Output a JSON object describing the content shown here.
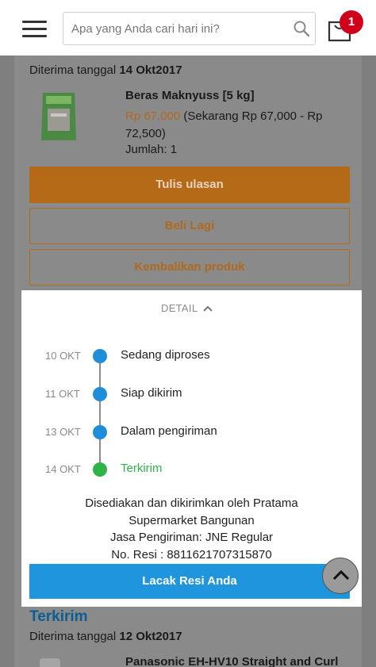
{
  "header": {
    "search_placeholder": "Apa yang Anda cari hari ini?",
    "cart_count": "1"
  },
  "order1": {
    "received_prefix": "Diterima tanggal",
    "received_date": "14 Okt2017",
    "product": {
      "name": "Beras Maknyuss [5 kg]",
      "price": "Rp 67,000",
      "price_range": "(Sekarang Rp 67,000 - Rp 72,500)",
      "qty": "Jumlah: 1"
    },
    "buttons": {
      "review": "Tulis ulasan",
      "buy_again": "Beli Lagi",
      "return": "Kembalikan produk"
    }
  },
  "detail": {
    "toggle_label": "DETAIL",
    "timeline": [
      {
        "date": "10 OKT",
        "label": "Sedang diproses",
        "status": "progress"
      },
      {
        "date": "11 OKT",
        "label": "Siap dikirim",
        "status": "progress"
      },
      {
        "date": "13 OKT",
        "label": "Dalam pengiriman",
        "status": "progress"
      },
      {
        "date": "14 OKT",
        "label": "Terkirim",
        "status": "done"
      }
    ],
    "seller_line": "Disediakan dan dikirimkan oleh Pratama Supermarket Bangunan",
    "courier": "Jasa Pengiriman: JNE Regular",
    "tracking_no": "No. Resi : 8811621707315870",
    "track_button": "Lacak Resi Anda"
  },
  "order2": {
    "status": "Terkirim",
    "received_prefix": "Diterima tanggal",
    "received_date": "12 Okt2017",
    "product_name": "Panasonic EH-HV10 Straight and Curl"
  },
  "colors": {
    "accent_orange": "#b56a17",
    "track_blue": "#1e95dc",
    "dot_blue": "#1e8ed8",
    "done_green": "#2db34a",
    "badge_red": "#d0021b"
  }
}
